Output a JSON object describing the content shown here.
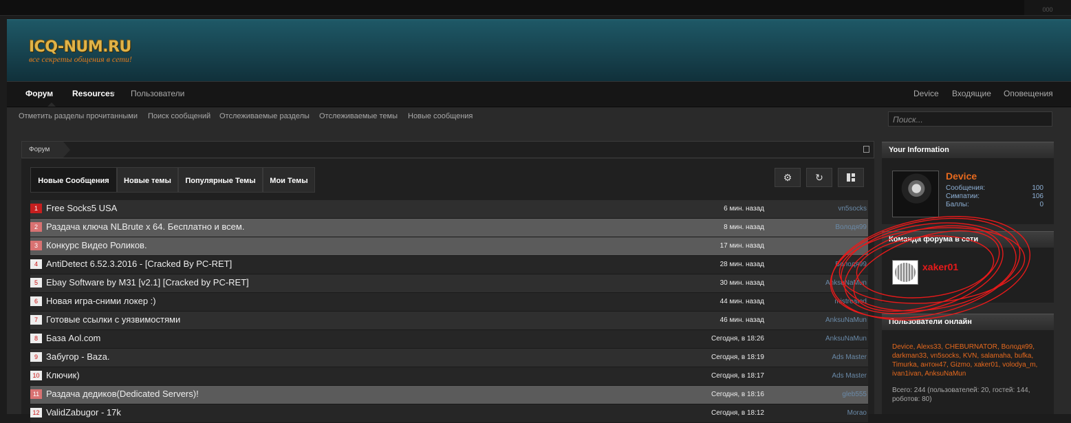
{
  "topbar": {
    "corner_text": "000"
  },
  "logo": {
    "title": "ICQ-NUM.RU",
    "tagline": "все секреты общения в сети!"
  },
  "nav": {
    "forum": "Форум",
    "resources": "Resources",
    "users": "Пользователи",
    "right": [
      "Device",
      "Входящие",
      "Оповещения"
    ]
  },
  "subnav": [
    "Отметить разделы прочитанными",
    "Поиск сообщений",
    "Отслеживаемые разделы",
    "Отслеживаемые темы",
    "Новые сообщения"
  ],
  "search": {
    "placeholder": "Поиск..."
  },
  "breadcrumb": {
    "label": "Форум"
  },
  "tabs": [
    "Новые Сообщения",
    "Новые темы",
    "Популярные Темы",
    "Мои Темы"
  ],
  "toolbar_icons": [
    "gear-icon",
    "refresh-icon",
    "layout-icon"
  ],
  "threads": [
    {
      "num": "1",
      "title": "Free Socks5 USA",
      "time": "6 мин. назад",
      "user": "vn5socks"
    },
    {
      "num": "2",
      "title": "Раздача ключа NLBrute x 64. Бесплатно и всем.",
      "time": "8 мин. назад",
      "user": "Володя99"
    },
    {
      "num": "3",
      "title": "Конкурс Видео Роликов.",
      "time": "17 мин. назад",
      "user": ""
    },
    {
      "num": "4",
      "title": "AntiDetect 6.52.3.2016 - [Cracked By PC-RET]",
      "time": "28 мин. назад",
      "user": "Володя99"
    },
    {
      "num": "5",
      "title": "Ebay Software by M31 [v2.1] [Cracked by PC-RET]",
      "time": "30 мин. назад",
      "user": "AnksuNaMun"
    },
    {
      "num": "6",
      "title": "Новая игра-сними локер :)",
      "time": "44 мин. назад",
      "user": "mistreated"
    },
    {
      "num": "7",
      "title": "Готовые ссылки с уязвимостями",
      "time": "46 мин. назад",
      "user": "AnksuNaMun"
    },
    {
      "num": "8",
      "title": "База Aol.com",
      "time": "Сегодня, в 18:26",
      "user": "AnksuNaMun"
    },
    {
      "num": "9",
      "title": "Забугор - Baza.",
      "time": "Сегодня, в 18:19",
      "user": "Ads Master"
    },
    {
      "num": "10",
      "title": "Ключик)",
      "time": "Сегодня, в 18:17",
      "user": "Ads Master"
    },
    {
      "num": "11",
      "title": "Раздача дедиков(Dedicated Servers)!",
      "time": "Сегодня, в 18:16",
      "user": "gleb555"
    },
    {
      "num": "12",
      "title": "ValidZabugor - 17k",
      "time": "Сегодня, в 18:12",
      "user": "Morao"
    }
  ],
  "your_info": {
    "heading": "Your Information",
    "username": "Device",
    "stats": [
      {
        "label": "Сообщения:",
        "value": "100"
      },
      {
        "label": "Симпатии:",
        "value": "106"
      },
      {
        "label": "Баллы:",
        "value": "0"
      }
    ]
  },
  "team": {
    "heading": "Команда форума в сети",
    "member": "xaker01"
  },
  "online": {
    "heading": "Пользователи онлайн",
    "users": "Device, Alexs33, CHEBURNATOR, Володя99, darkman33, vn5socks, KVN, salamaha, bufka, Timurka, антон47, Gizmo, xaker01, volodya_m, ivan1ivan, AnksuNaMun",
    "total": "Всего: 244 (пользователей: 20, гостей: 144, роботов: 80)"
  },
  "colors": {
    "accent": "#e86a1e",
    "badge": "#c61f1f",
    "header": "#1e5866",
    "annotation": "#e81a1a"
  }
}
